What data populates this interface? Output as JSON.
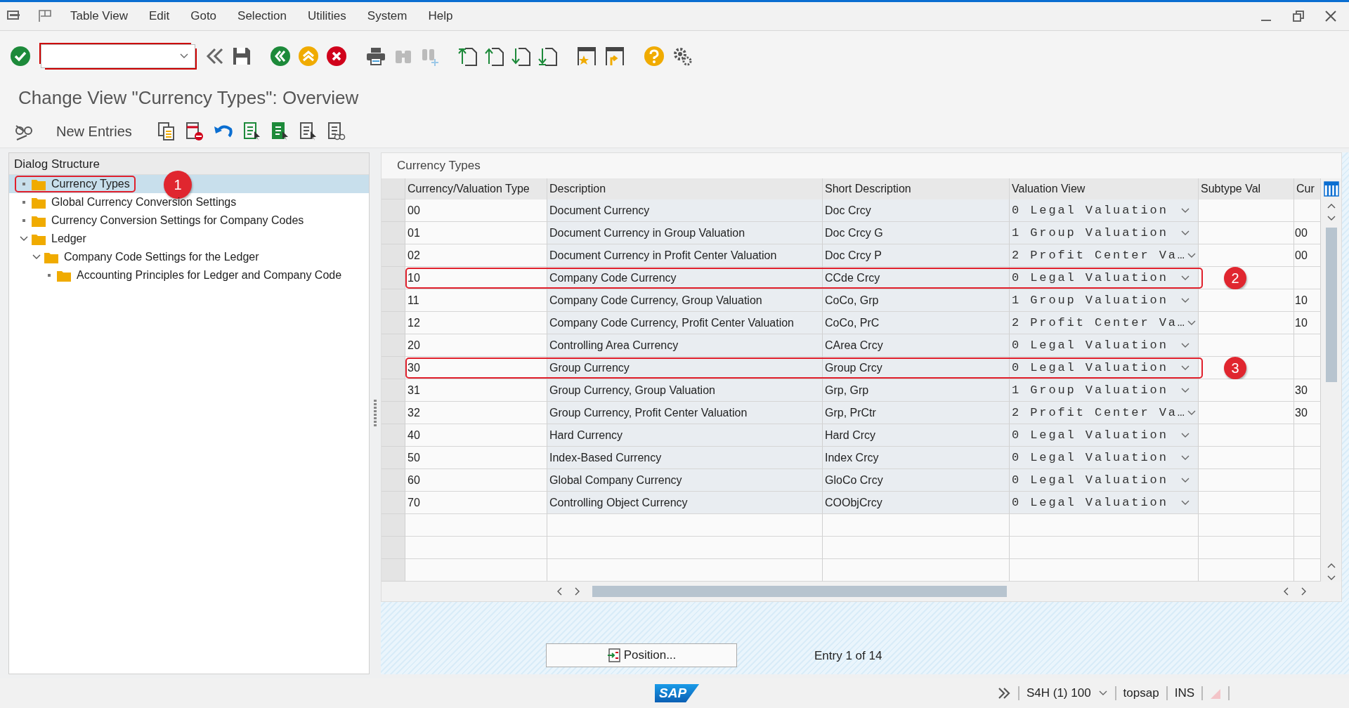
{
  "menu": {
    "items": [
      "Table View",
      "Edit",
      "Goto",
      "Selection",
      "Utilities",
      "System",
      "Help"
    ]
  },
  "title": "Change View \"Currency Types\": Overview",
  "app_toolbar": {
    "new_entries": "New Entries"
  },
  "dialog_structure": {
    "title": "Dialog Structure",
    "tree": [
      {
        "label": "Currency Types",
        "selected": true,
        "callout": "1"
      },
      {
        "label": "Global Currency Conversion Settings",
        "selected": false
      },
      {
        "label": "Currency Conversion Settings for Company Codes",
        "selected": false
      },
      {
        "label": "Ledger",
        "selected": false,
        "expanded": true,
        "children": [
          {
            "label": "Company Code Settings for the Ledger",
            "selected": false,
            "expanded": true,
            "children": [
              {
                "label": "Accounting Principles for Ledger and Company Code",
                "selected": false
              }
            ]
          }
        ]
      }
    ]
  },
  "table": {
    "title": "Currency Types",
    "columns": [
      "Currency/Valuation Type",
      "Description",
      "Short Description",
      "Valuation View",
      "Subtype Val",
      "Cur"
    ],
    "rows": [
      {
        "type": "00",
        "description": "Document Currency",
        "short": "Doc Crcy",
        "valuation": "0 Legal Valuation"
      },
      {
        "type": "01",
        "description": "Document Currency in Group Valuation",
        "short": "Doc Crcy G",
        "valuation": "1 Group Valuation",
        "cur": "00"
      },
      {
        "type": "02",
        "description": "Document Currency in Profit Center Valuation",
        "short": "Doc Crcy P",
        "valuation": "2 Profit Center Va…",
        "cur": "00"
      },
      {
        "type": "10",
        "description": "Company Code Currency",
        "short": "CCde Crcy",
        "valuation": "0 Legal Valuation",
        "callout": "2"
      },
      {
        "type": "11",
        "description": "Company Code Currency, Group Valuation",
        "short": "CoCo, Grp",
        "valuation": "1 Group Valuation",
        "cur": "10"
      },
      {
        "type": "12",
        "description": "Company Code Currency, Profit Center Valuation",
        "short": "CoCo, PrC",
        "valuation": "2 Profit Center Va…",
        "cur": "10"
      },
      {
        "type": "20",
        "description": "Controlling Area Currency",
        "short": "CArea Crcy",
        "valuation": "0 Legal Valuation"
      },
      {
        "type": "30",
        "description": "Group Currency",
        "short": "Group Crcy",
        "valuation": "0 Legal Valuation",
        "callout": "3"
      },
      {
        "type": "31",
        "description": "Group Currency, Group Valuation",
        "short": "Grp, Grp",
        "valuation": "1 Group Valuation",
        "cur": "30"
      },
      {
        "type": "32",
        "description": "Group Currency, Profit Center Valuation",
        "short": "Grp, PrCtr",
        "valuation": "2 Profit Center Va…",
        "cur": "30"
      },
      {
        "type": "40",
        "description": "Hard Currency",
        "short": "Hard Crcy",
        "valuation": "0 Legal Valuation"
      },
      {
        "type": "50",
        "description": "Index-Based Currency",
        "short": "Index Crcy",
        "valuation": "0 Legal Valuation"
      },
      {
        "type": "60",
        "description": "Global Company Currency",
        "short": "GloCo Crcy",
        "valuation": "0 Legal Valuation"
      },
      {
        "type": "70",
        "description": "Controlling Object Currency",
        "short": "COObjCrcy",
        "valuation": "0 Legal Valuation"
      }
    ]
  },
  "footer": {
    "position_button": "Position...",
    "entry_info": "Entry 1 of 14"
  },
  "status_bar": {
    "logo": "SAP",
    "system": "S4H (1) 100",
    "user": "topsap",
    "mode": "INS"
  }
}
